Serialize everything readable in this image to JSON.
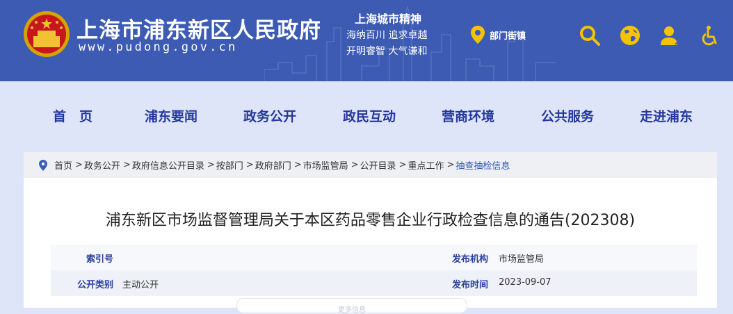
{
  "header": {
    "title": "上海市浦东新区人民政府",
    "url": "www.pudong.gov.cn",
    "spirit_title": "上海城市精神",
    "spirit_line1": "海纳百川  追求卓越",
    "spirit_line2": "开明睿智  大气谦和",
    "street_label": "部门街镇",
    "icons": [
      "location-icon",
      "search-icon",
      "globe-icon",
      "user-icon",
      "accessibility-icon"
    ],
    "accent_color": "#3d5bb3",
    "icon_color": "#f5c400"
  },
  "nav": {
    "items": [
      "首　页",
      "浦东要闻",
      "政务公开",
      "政民互动",
      "营商环境",
      "公共服务",
      "走进浦东"
    ]
  },
  "breadcrumb": {
    "items": [
      "首页",
      "政务公开",
      "政府信息公开目录",
      "按部门",
      "政府部门",
      "市场监管局",
      "公开目录",
      "重点工作"
    ],
    "current": "抽查抽检信息",
    "separator": ">"
  },
  "article": {
    "title": "浦东新区市场监督管理局关于本区药品零售企业行政检查信息的通告(202308)",
    "meta": {
      "index_label": "索引号",
      "index_value": "",
      "org_label": "发布机构",
      "org_value": "市场监管局",
      "category_label": "公开类别",
      "category_value": "主动公开",
      "date_label": "发布时间",
      "date_value": "2023-09-07"
    },
    "more_label": "更多信息"
  }
}
